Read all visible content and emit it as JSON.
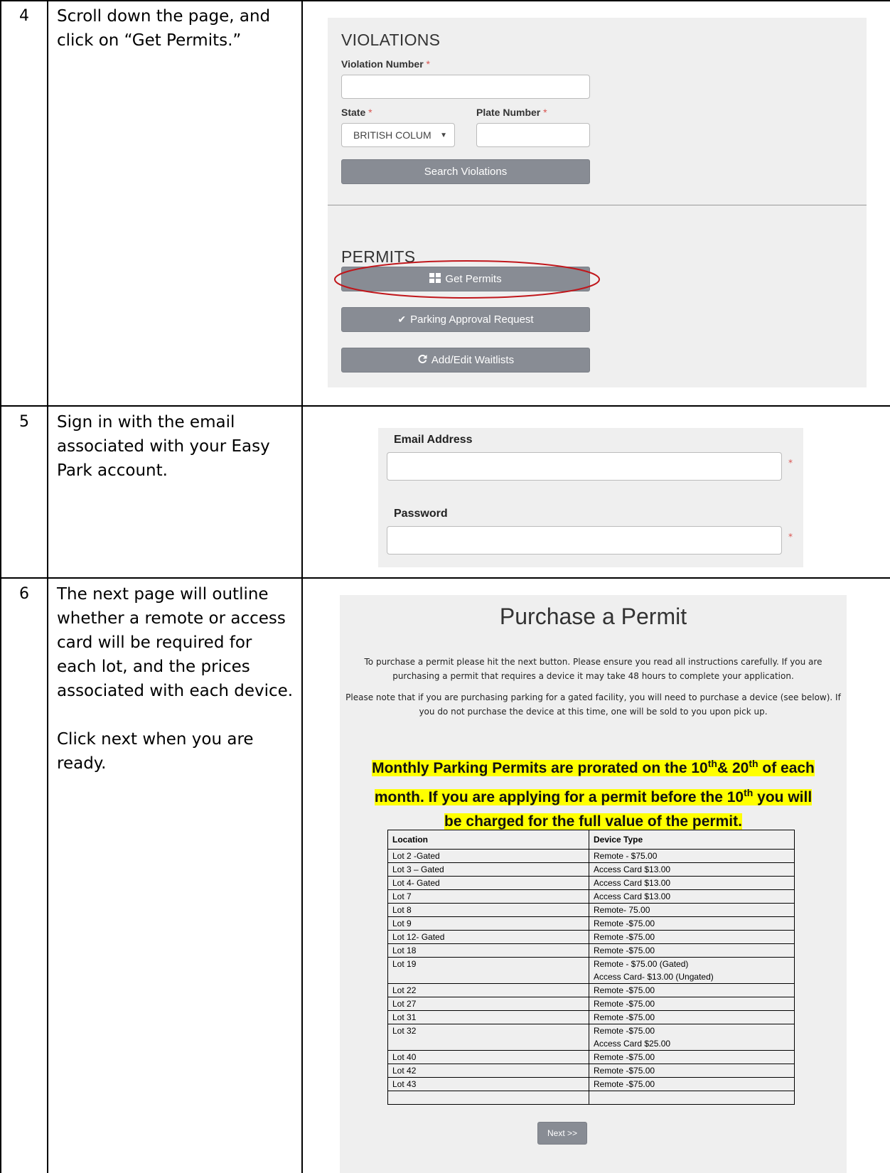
{
  "steps": [
    {
      "number": "4",
      "text": [
        "Scroll down the page, and click on “Get Permits.”"
      ]
    },
    {
      "number": "5",
      "text": [
        "Sign in with the email associated with your Easy Park account."
      ]
    },
    {
      "number": "6",
      "text": [
        "The next page will outline whether a remote or access card will be required for each lot, and the prices associated with each device.",
        "Click next when you are ready."
      ]
    }
  ],
  "violations": {
    "heading": "VIOLATIONS",
    "violation_number_label": "Violation Number",
    "state_label": "State",
    "plate_number_label": "Plate Number",
    "required_mark": "*",
    "state_value": "BRITISH COLUM",
    "search_button": "Search Violations"
  },
  "permits": {
    "heading": "PERMITS",
    "get_permits": "Get Permits",
    "parking_approval": "Parking Approval Request",
    "waitlists": "Add/Edit Waitlists"
  },
  "signin": {
    "email_label": "Email Address",
    "password_label": "Password",
    "required_mark": "*"
  },
  "purchase": {
    "title": "Purchase a Permit",
    "para1": "To purchase a permit please hit the next button. Please ensure you read all instructions carefully. If you are purchasing a permit that requires a device it may take 48 hours to complete your application.",
    "para2": "Please note that if you are purchasing parking for a gated facility, you will need to purchase a device (see below). If you do not purchase the device at this time, one will be sold to you upon pick up.",
    "notice_line1_a": "Monthly Parking Permits are prorated on the 10",
    "notice_sup1": "th",
    "notice_line1_b": "& 20",
    "notice_sup2": "th",
    "notice_line1_c": " of each",
    "notice_line2_a": "month. If you are applying for a permit before the 10",
    "notice_sup3": "th",
    "notice_line2_b": " you will",
    "notice_line3": "be charged for the full value of the permit.",
    "col_location": "Location",
    "col_device": "Device Type",
    "rows": [
      {
        "location": "Lot 2 -Gated",
        "device": [
          "Remote - $75.00"
        ]
      },
      {
        "location": "Lot 3 – Gated",
        "device": [
          "Access Card $13.00"
        ]
      },
      {
        "location": "Lot 4- Gated",
        "device": [
          "Access Card $13.00"
        ]
      },
      {
        "location": "Lot 7",
        "device": [
          "Access Card $13.00"
        ]
      },
      {
        "location": "Lot 8",
        "device": [
          "Remote- 75.00"
        ]
      },
      {
        "location": "Lot 9",
        "device": [
          "Remote -$75.00"
        ]
      },
      {
        "location": "Lot 12- Gated",
        "device": [
          "Remote -$75.00"
        ]
      },
      {
        "location": "Lot 18",
        "device": [
          "Remote -$75.00"
        ]
      },
      {
        "location": "Lot 19",
        "device": [
          "Remote - $75.00 (Gated)",
          "Access Card- $13.00 (Ungated)"
        ]
      },
      {
        "location": "Lot 22",
        "device": [
          "Remote -$75.00"
        ]
      },
      {
        "location": "Lot 27",
        "device": [
          "Remote -$75.00"
        ]
      },
      {
        "location": "Lot 31",
        "device": [
          "Remote -$75.00"
        ]
      },
      {
        "location": "Lot 32",
        "device": [
          "Remote -$75.00",
          "Access Card $25.00"
        ]
      },
      {
        "location": "Lot 40",
        "device": [
          "Remote -$75.00"
        ]
      },
      {
        "location": "Lot 42",
        "device": [
          "Remote -$75.00"
        ]
      },
      {
        "location": "Lot 43",
        "device": [
          "Remote -$75.00"
        ]
      }
    ],
    "next_button": "Next >>"
  },
  "colors": {
    "button": "#888c94",
    "panel": "#efefef",
    "highlight": "#ffff00",
    "annotation": "#c0161b"
  }
}
